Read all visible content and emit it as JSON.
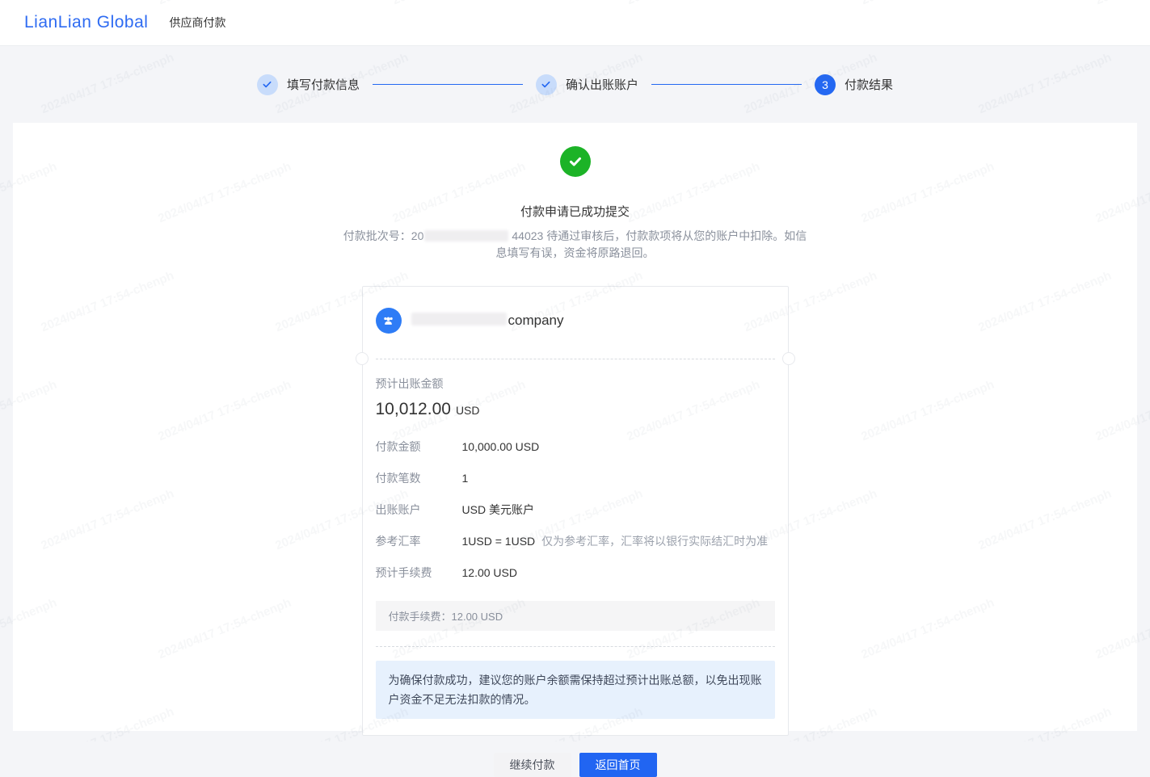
{
  "watermark": {
    "text": "2024/04/17 17:54-chenph"
  },
  "header": {
    "logo": "LianLian Global",
    "product": "供应商付款"
  },
  "stepper": {
    "steps": [
      {
        "label": "填写付款信息",
        "state": "done"
      },
      {
        "label": "确认出账账户",
        "state": "done"
      },
      {
        "label": "付款结果",
        "state": "current",
        "number": "3"
      }
    ]
  },
  "result": {
    "title": "付款申请已成功提交",
    "desc_prefix": "付款批次号：20",
    "desc_suffix": "44023 待通过审核后，付款款项将从您的账户中扣除。如信息填写有误，资金将原路退回。"
  },
  "card": {
    "company_suffix": "company",
    "summary": {
      "label": "预计出账金额",
      "amount": "10,012.00",
      "currency": "USD"
    },
    "rows": [
      {
        "label": "付款金额",
        "value": "10,000.00 USD"
      },
      {
        "label": "付款笔数",
        "value": "1"
      },
      {
        "label": "出账账户",
        "value": "USD 美元账户"
      },
      {
        "label": "参考汇率",
        "value": "1USD = 1USD",
        "note": "仅为参考汇率，汇率将以银行实际结汇时为准"
      },
      {
        "label": "预计手续费",
        "value": "12.00 USD"
      }
    ],
    "fee_box": "付款手续费：12.00 USD",
    "notice": "为确保付款成功，建议您的账户余额需保持超过预计出账总额，以免出现账户资金不足无法扣款的情况。"
  },
  "actions": {
    "continue_label": "继续付款",
    "home_label": "返回首页"
  },
  "colors": {
    "accent": "#2468f2",
    "success_green": "#1cb327",
    "notice_bg": "#e7f1fd"
  }
}
